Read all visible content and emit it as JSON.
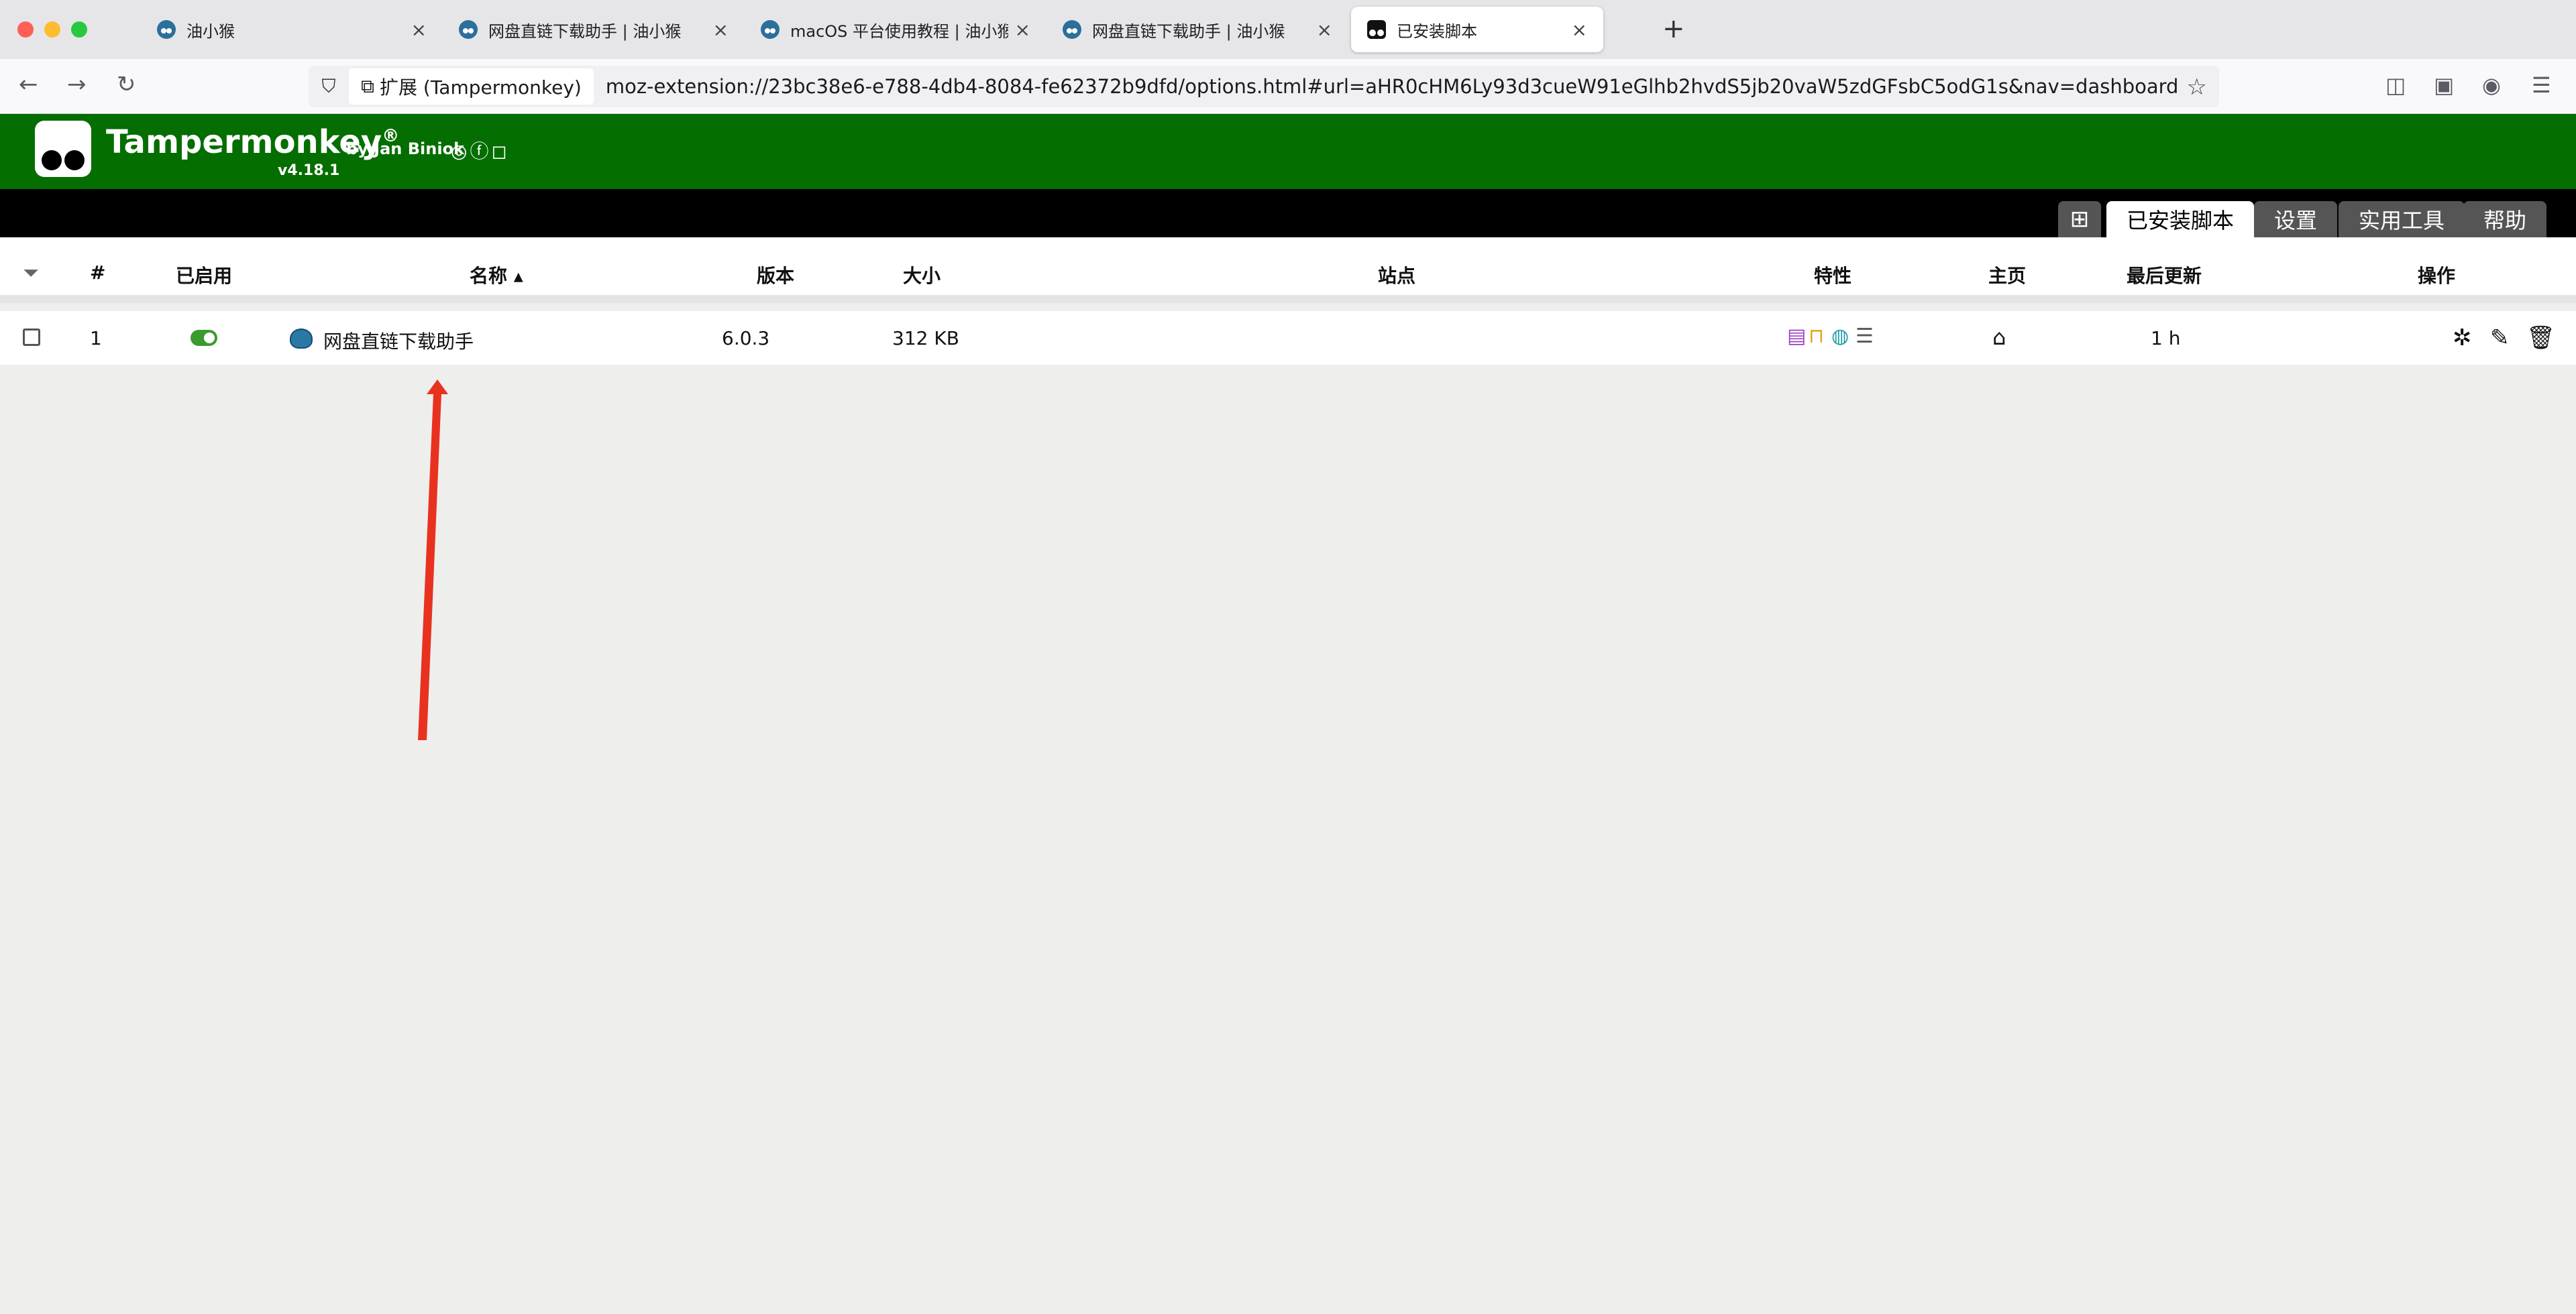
{
  "browser": {
    "tabs": [
      {
        "title": "油小猴",
        "active": false
      },
      {
        "title": "网盘直链下载助手 | 油小猴",
        "active": false
      },
      {
        "title": "macOS 平台使用教程 | 油小猴",
        "active": false
      },
      {
        "title": "网盘直链下载助手 | 油小猴",
        "active": false
      },
      {
        "title": "已安装脚本",
        "active": true
      }
    ],
    "new_tab": "+",
    "extension_chip": "扩展 (Tampermonkey)",
    "url": "moz-extension://23bc38e6-e788-4db4-8084-fe62372b9dfd/options.html#url=aHR0cHM6Ly93d3cueW91eGlhb2hvdS5jb20vaW5zdGFsbC5odG1s&nav=dashboard"
  },
  "tm": {
    "name": "Tampermonkey",
    "reg": "®",
    "author": "by Jan Biniok",
    "version": "v4.18.1",
    "tabs": {
      "plus": "⊞",
      "installed": "已安装脚本",
      "settings": "设置",
      "utilities": "实用工具",
      "help": "帮助"
    }
  },
  "table": {
    "headers": {
      "num": "#",
      "enabled": "已启用",
      "name": "名称 ▴",
      "version": "版本",
      "size": "大小",
      "sites": "站点",
      "features": "特性",
      "homepage": "主页",
      "updated": "最后更新",
      "actions": "操作"
    },
    "rows": [
      {
        "num": "1",
        "enabled": true,
        "name": "网盘直链下载助手",
        "version": "6.0.3",
        "size": "312 KB",
        "sites": "",
        "updated": "1 h"
      }
    ]
  },
  "colors": {
    "tm_green": "#046e00",
    "toggle_on": "#3a9b2e",
    "annotation_arrow": "#e8321f"
  },
  "icons": {
    "features": [
      "document-icon",
      "lock-icon",
      "globe-icon",
      "database-icon"
    ],
    "actions": [
      "debug-icon",
      "edit-icon",
      "trash-icon"
    ]
  }
}
